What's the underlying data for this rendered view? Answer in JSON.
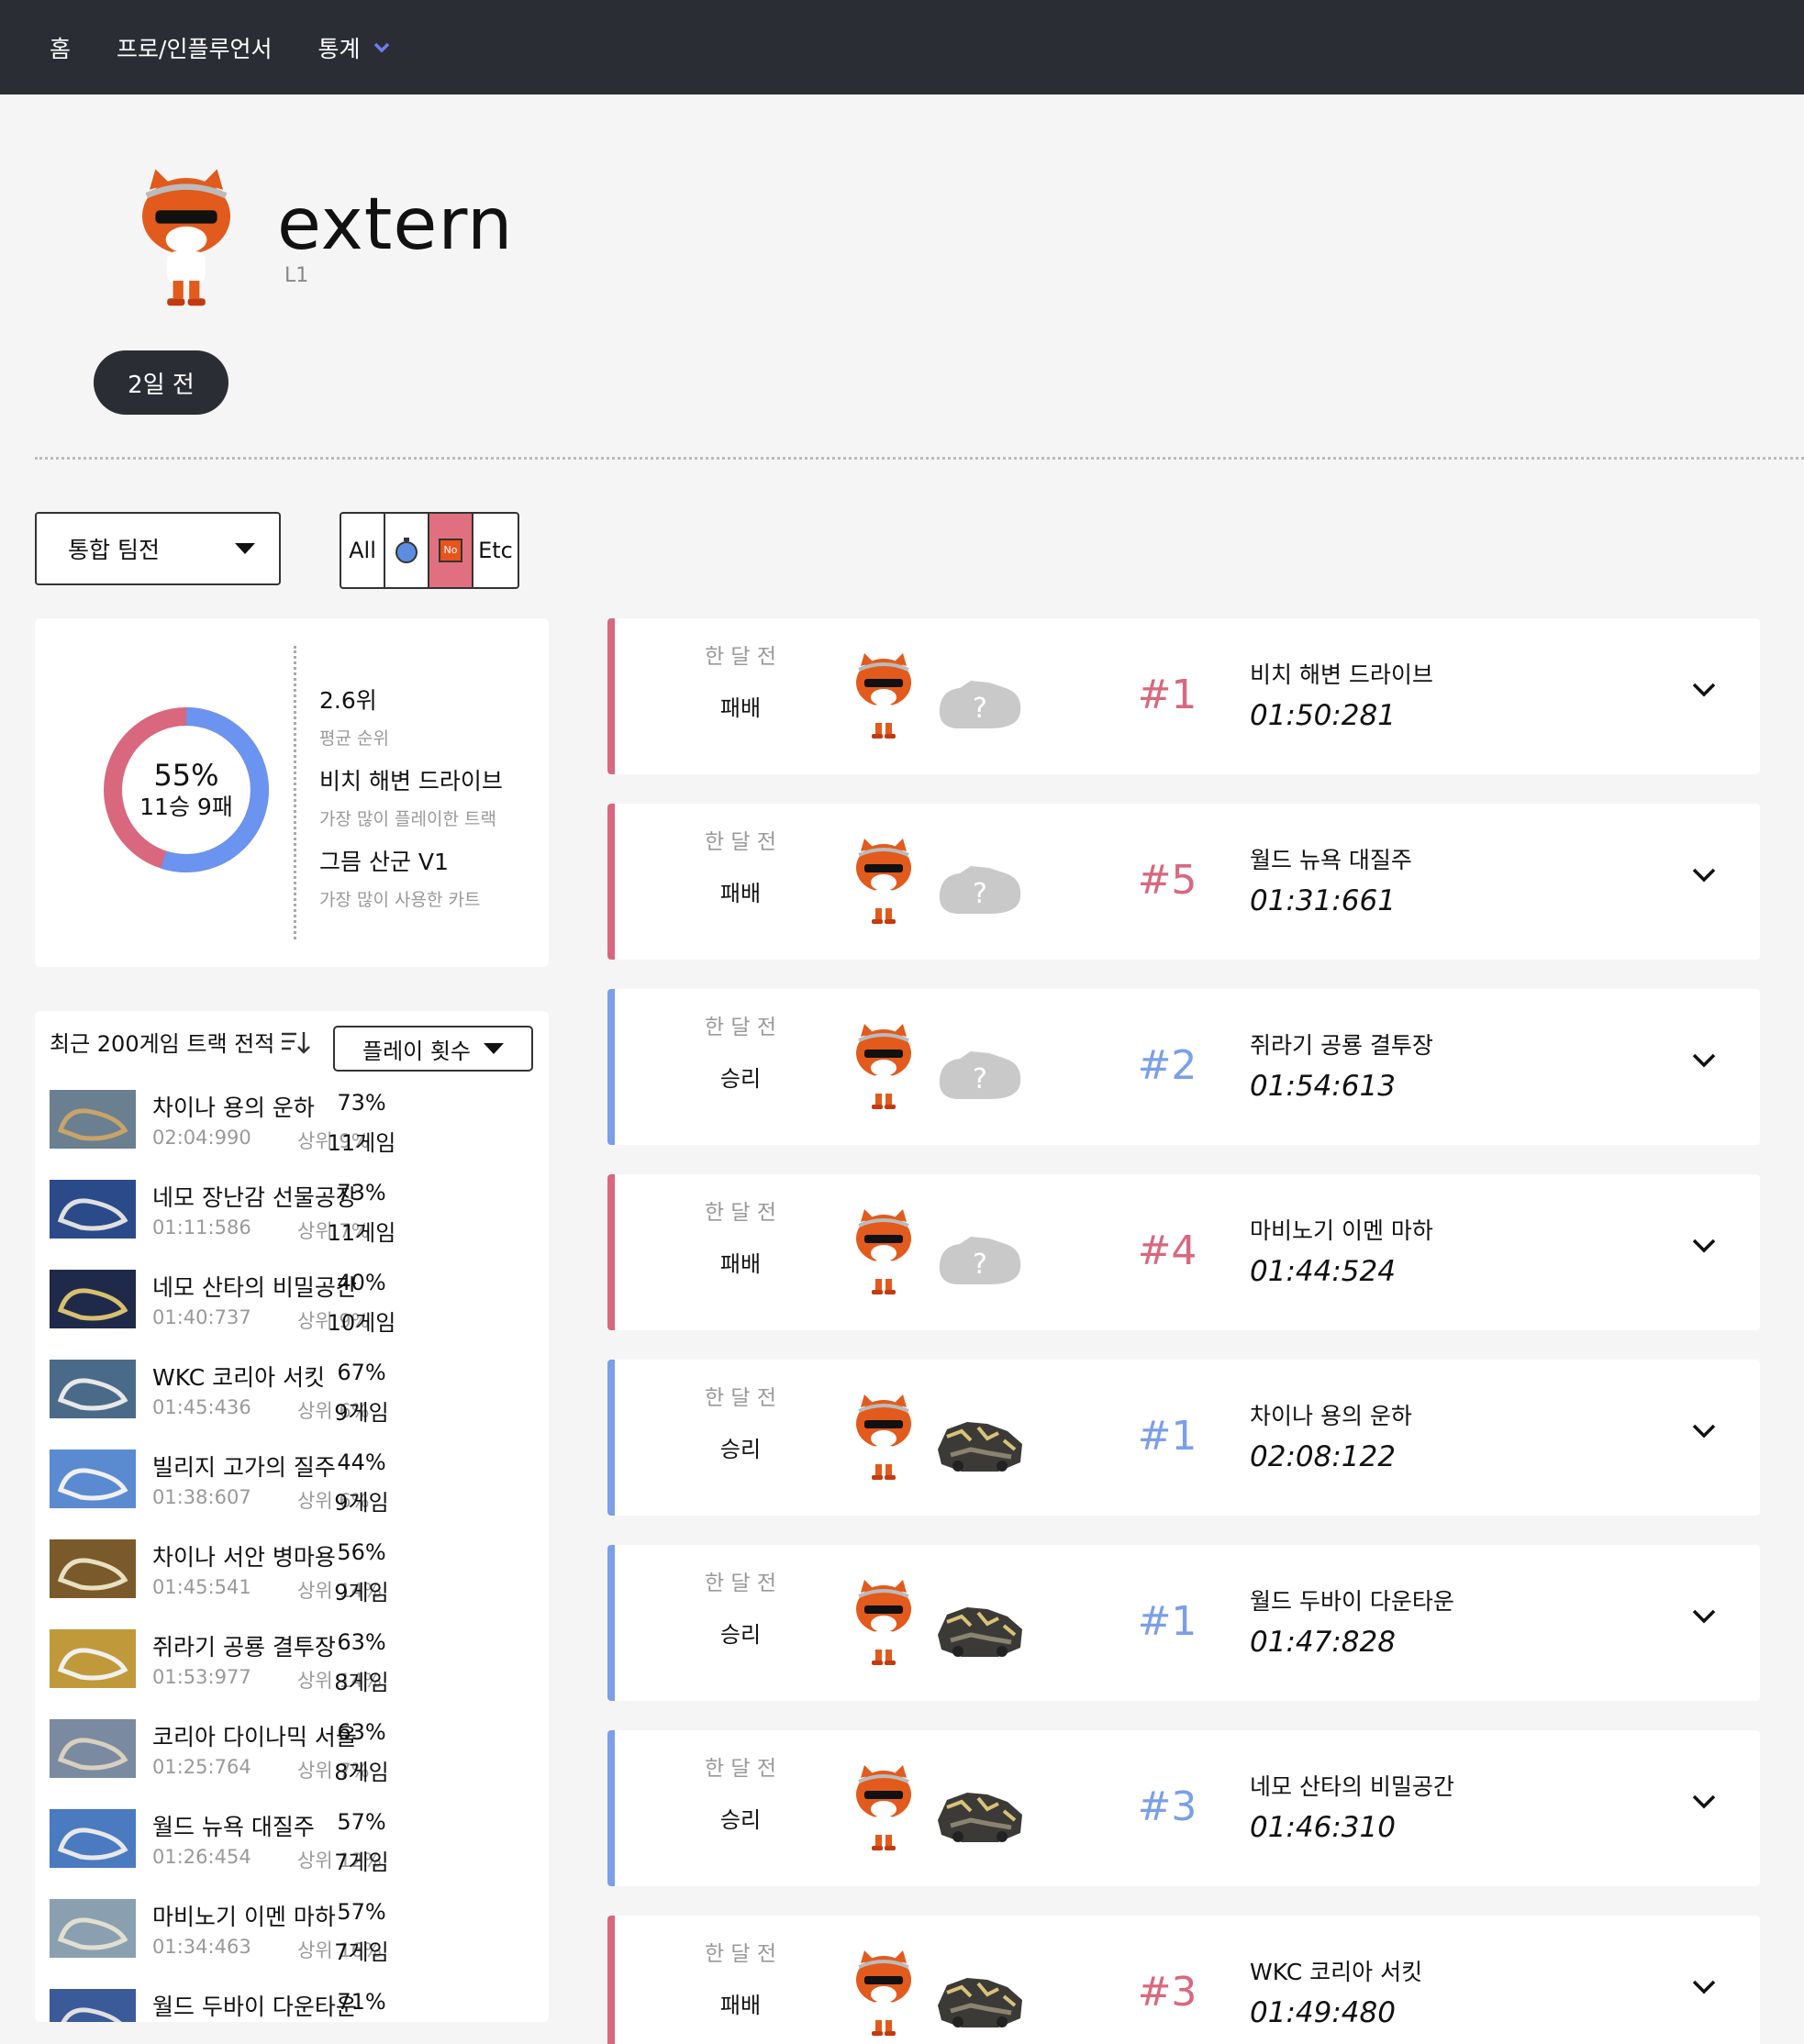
{
  "nav": {
    "home": "홈",
    "pro": "프로/인플루언서",
    "stats": "통계"
  },
  "profile": {
    "name": "extern",
    "level": "L1",
    "last_active": "2일 전"
  },
  "filters": {
    "mode": "통합 팀전",
    "buttons": [
      "All",
      "Etc"
    ],
    "active_index": 2
  },
  "summary": {
    "win_pct": "55%",
    "record": "11승 9패",
    "win_fraction": 0.55,
    "avg_rank": "2.6위",
    "avg_rank_label": "평균 순위",
    "top_track": "비치 해변 드라이브",
    "top_track_label": "가장 많이 플레이한 트랙",
    "top_kart": "그믐 산군 V1",
    "top_kart_label": "가장 많이 사용한 카트"
  },
  "tracks": {
    "title": "최근 200게임 트랙 전적",
    "sort_label": "플레이 횟수",
    "rows": [
      {
        "name": "차이나 용의 운하",
        "time": "02:04:990",
        "top": "상위 9%",
        "pct": "73%",
        "games": "11게임"
      },
      {
        "name": "네모 장난감 선물공장",
        "time": "01:11:586",
        "top": "상위 7%",
        "pct": "73%",
        "games": "11게임"
      },
      {
        "name": "네모 산타의 비밀공간",
        "time": "01:40:737",
        "top": "상위 9%",
        "pct": "40%",
        "games": "10게임"
      },
      {
        "name": "WKC 코리아 서킷",
        "time": "01:45:436",
        "top": "상위 6%",
        "pct": "67%",
        "games": "9게임"
      },
      {
        "name": "빌리지 고가의 질주",
        "time": "01:38:607",
        "top": "상위 6%",
        "pct": "44%",
        "games": "9게임"
      },
      {
        "name": "차이나 서안 병마용",
        "time": "01:45:541",
        "top": "상위 14%",
        "pct": "56%",
        "games": "9게임"
      },
      {
        "name": "쥐라기 공룡 결투장",
        "time": "01:53:977",
        "top": "상위 14%",
        "pct": "63%",
        "games": "8게임"
      },
      {
        "name": "코리아 다이나믹 서울",
        "time": "01:25:764",
        "top": "상위 7%",
        "pct": "63%",
        "games": "8게임"
      },
      {
        "name": "월드 뉴욕 대질주",
        "time": "01:26:454",
        "top": "상위 12%",
        "pct": "57%",
        "games": "7게임"
      },
      {
        "name": "마비노기 이멘 마하",
        "time": "01:34:463",
        "top": "상위 16%",
        "pct": "57%",
        "games": "7게임"
      },
      {
        "name": "월드 두바이 다운타운",
        "time": "",
        "top": "",
        "pct": "71%",
        "games": ""
      }
    ]
  },
  "matches": [
    {
      "when": "한 달 전",
      "result": "패배",
      "rank": "#1",
      "track": "비치 해변 드라이브",
      "time": "01:50:281",
      "kart": "unknown"
    },
    {
      "when": "한 달 전",
      "result": "패배",
      "rank": "#5",
      "track": "월드 뉴욕 대질주",
      "time": "01:31:661",
      "kart": "unknown"
    },
    {
      "when": "한 달 전",
      "result": "승리",
      "rank": "#2",
      "track": "쥐라기 공룡 결투장",
      "time": "01:54:613",
      "kart": "unknown"
    },
    {
      "when": "한 달 전",
      "result": "패배",
      "rank": "#4",
      "track": "마비노기 이멘 마하",
      "time": "01:44:524",
      "kart": "unknown"
    },
    {
      "when": "한 달 전",
      "result": "승리",
      "rank": "#1",
      "track": "차이나 용의 운하",
      "time": "02:08:122",
      "kart": "tiger"
    },
    {
      "when": "한 달 전",
      "result": "승리",
      "rank": "#1",
      "track": "월드 두바이 다운타운",
      "time": "01:47:828",
      "kart": "tiger"
    },
    {
      "when": "한 달 전",
      "result": "승리",
      "rank": "#3",
      "track": "네모 산타의 비밀공간",
      "time": "01:46:310",
      "kart": "tiger"
    },
    {
      "when": "한 달 전",
      "result": "패배",
      "rank": "#3",
      "track": "WKC 코리아 서킷",
      "time": "01:49:480",
      "kart": "tiger"
    }
  ],
  "colors": {
    "win": "#7b9fe8",
    "loss": "#d9677e",
    "nav": "#2b2d35"
  }
}
